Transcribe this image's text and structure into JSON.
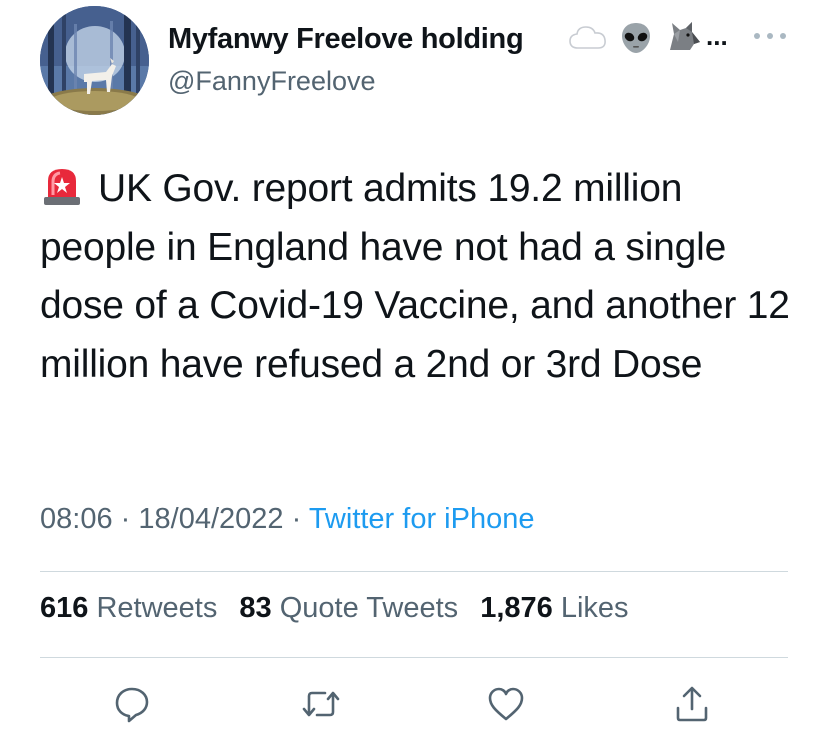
{
  "author": {
    "name": "Myfanwy Freelove holding",
    "name_emojis": [
      "cloud-icon",
      "alien-icon",
      "wolf-icon"
    ],
    "name_truncation": "...",
    "handle": "@FannyFreelove"
  },
  "tweet": {
    "leading_emoji": "police-siren-icon",
    "text": "UK Gov. report admits 19.2 million people in England have not had a single dose of a Covid-19 Vaccine, and another 12 million have refused a 2nd or 3rd Dose"
  },
  "meta": {
    "time": "08:06",
    "separator": "·",
    "date": "18/04/2022",
    "source": "Twitter for iPhone"
  },
  "stats": {
    "retweets_count": "616",
    "retweets_label": "Retweets",
    "quotes_count": "83",
    "quotes_label": "Quote Tweets",
    "likes_count": "1,876",
    "likes_label": "Likes"
  },
  "colors": {
    "text": "#0f1419",
    "secondary": "#536471",
    "link": "#1d9bf0",
    "divider": "#cfd9de"
  },
  "actions": [
    "reply-icon",
    "retweet-icon",
    "like-icon",
    "share-icon"
  ]
}
